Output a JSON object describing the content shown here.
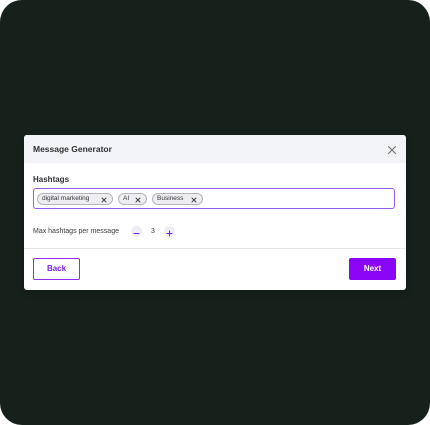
{
  "modal": {
    "title": "Message Generator",
    "close_icon": "close-icon"
  },
  "hashtags": {
    "label": "Hashtags",
    "tags": [
      "digital marketing",
      "AI",
      "Business"
    ],
    "remove_icon": "close-icon"
  },
  "max_hashtags": {
    "label": "Max hashtags per message",
    "value": "3",
    "decrement_icon": "minus-icon",
    "increment_icon": "plus-icon"
  },
  "footer": {
    "back_label": "Back",
    "next_label": "Next"
  },
  "colors": {
    "accent": "#8b06f6",
    "input_border": "#9a5cf0",
    "backdrop": "#17211c",
    "header_bg": "#f3f4f8"
  }
}
